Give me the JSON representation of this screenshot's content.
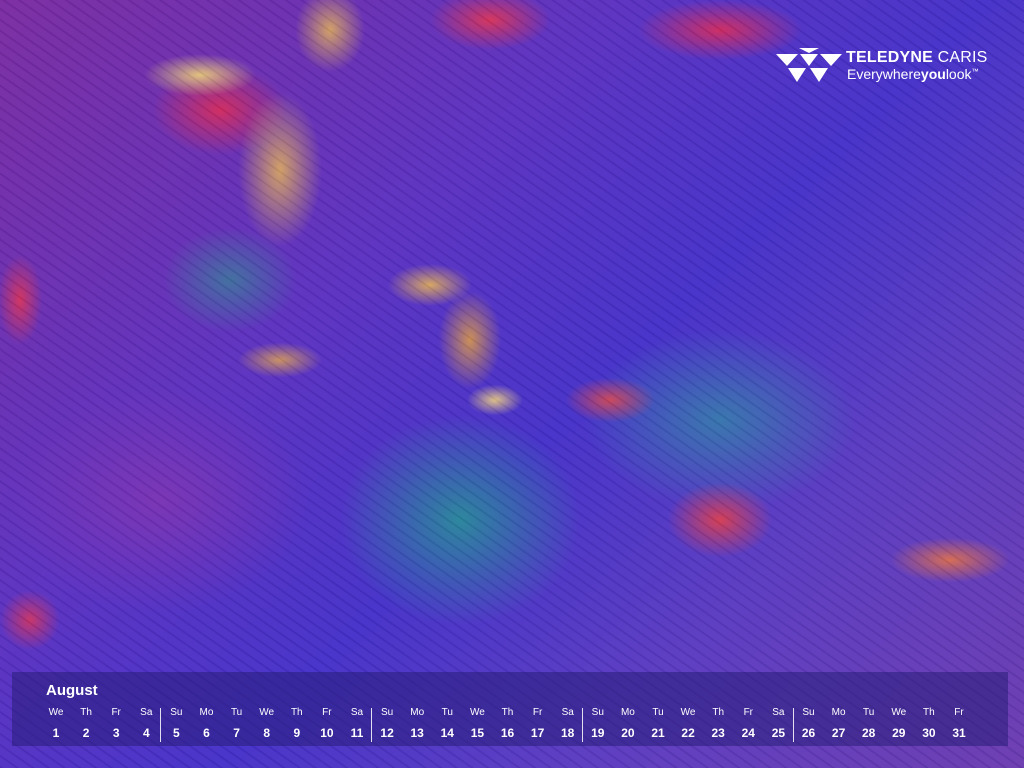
{
  "logo": {
    "brand_bold": "TELEDYNE",
    "brand_light": "CARIS",
    "tagline_a": "Everywhere",
    "tagline_b": "you",
    "tagline_c": "look",
    "tagline_tm": "™"
  },
  "calendar": {
    "month": "August",
    "days": [
      {
        "dow": "We",
        "num": "1"
      },
      {
        "dow": "Th",
        "num": "2"
      },
      {
        "dow": "Fr",
        "num": "3"
      },
      {
        "dow": "Sa",
        "num": "4"
      },
      {
        "dow": "Su",
        "num": "5"
      },
      {
        "dow": "Mo",
        "num": "6"
      },
      {
        "dow": "Tu",
        "num": "7"
      },
      {
        "dow": "We",
        "num": "8"
      },
      {
        "dow": "Th",
        "num": "9"
      },
      {
        "dow": "Fr",
        "num": "10"
      },
      {
        "dow": "Sa",
        "num": "11"
      },
      {
        "dow": "Su",
        "num": "12"
      },
      {
        "dow": "Mo",
        "num": "13"
      },
      {
        "dow": "Tu",
        "num": "14"
      },
      {
        "dow": "We",
        "num": "15"
      },
      {
        "dow": "Th",
        "num": "16"
      },
      {
        "dow": "Fr",
        "num": "17"
      },
      {
        "dow": "Sa",
        "num": "18"
      },
      {
        "dow": "Su",
        "num": "19"
      },
      {
        "dow": "Mo",
        "num": "20"
      },
      {
        "dow": "Tu",
        "num": "21"
      },
      {
        "dow": "We",
        "num": "22"
      },
      {
        "dow": "Th",
        "num": "23"
      },
      {
        "dow": "Fr",
        "num": "24"
      },
      {
        "dow": "Sa",
        "num": "25"
      },
      {
        "dow": "Su",
        "num": "26"
      },
      {
        "dow": "Mo",
        "num": "27"
      },
      {
        "dow": "Tu",
        "num": "28"
      },
      {
        "dow": "We",
        "num": "29"
      },
      {
        "dow": "Th",
        "num": "30"
      },
      {
        "dow": "Fr",
        "num": "31"
      }
    ]
  },
  "colors": {
    "calendar_bg": "#281e78",
    "text": "#ffffff",
    "terrain_high": "#e0c070",
    "terrain_ridge": "#e02850",
    "terrain_low": "#5030c0",
    "terrain_basin": "#1ea08c"
  }
}
